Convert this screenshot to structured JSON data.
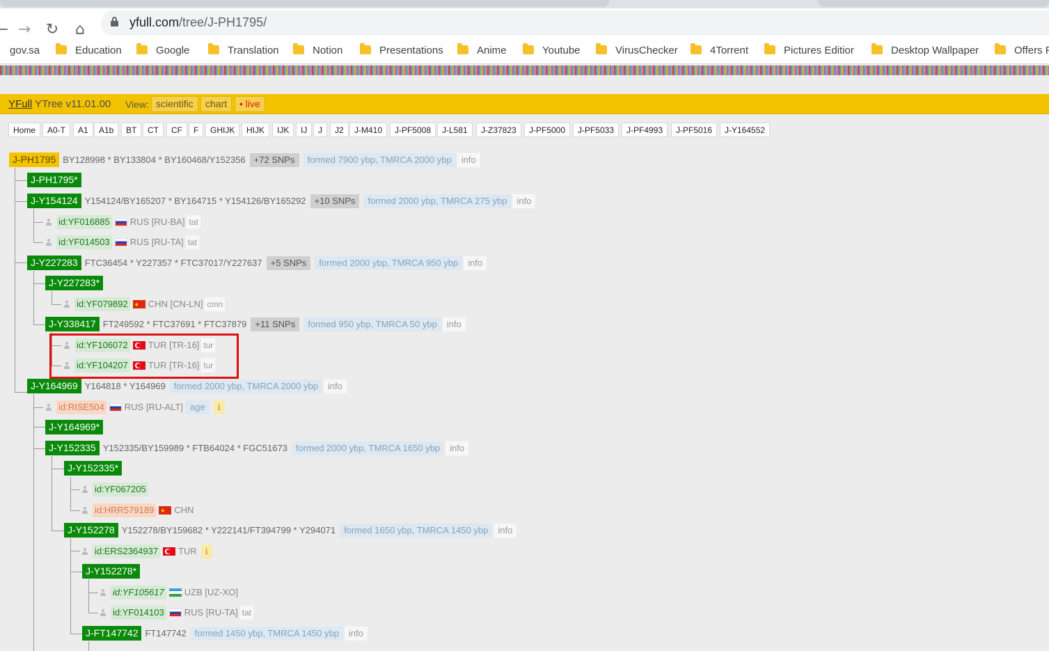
{
  "browser": {
    "url_host": "yfull.com",
    "url_path": "/tree/J-PH1795/",
    "bookmarks": [
      "gov.sa",
      "Education",
      "Google",
      "Translation",
      "Notion",
      "Presentations",
      "Anime",
      "Youtube",
      "VirusChecker",
      "4Torrent",
      "Pictures Editior",
      "Desktop Wallpaper",
      "Offers F"
    ]
  },
  "header": {
    "brand": "YFull",
    "title_rest": " YTree v11.01.00",
    "view_label": "View:",
    "views": [
      "scientific",
      "chart",
      "• live"
    ]
  },
  "nav_tabs": [
    "Home",
    "A0-T",
    "A1",
    "A1b",
    "BT",
    "CT",
    "CF",
    "F",
    "GHIJK",
    "HIJK",
    "IJK",
    "IJ",
    "J",
    "J2",
    "J-M410",
    "J-PF5008",
    "J-L581",
    "J-Z37823",
    "J-PF5000",
    "J-PF5033",
    "J-PF4993",
    "J-PF5016",
    "J-Y164552"
  ],
  "tree": {
    "root": {
      "name": "J-PH1795",
      "snps": "BY128998 * BY133804 * BY160468/Y152356",
      "more": "+72 SNPs",
      "formed": "formed 7900 ybp, TMRCA 2000 ybp",
      "info": "info"
    },
    "n1": {
      "name": "J-PH1795*"
    },
    "n2": {
      "name": "J-Y154124",
      "snps": "Y154124/BY165207 * BY164715 * Y154126/BY165292",
      "more": "+10 SNPs",
      "formed": "formed 2000 ybp, TMRCA 275 ybp",
      "info": "info"
    },
    "s1": {
      "id": "id:YF016885",
      "loc": "RUS [RU-BA]",
      "lang": "tat"
    },
    "s2": {
      "id": "id:YF014503",
      "loc": "RUS [RU-TA]",
      "lang": "tat"
    },
    "n3": {
      "name": "J-Y227283",
      "snps": "FTC36454 * Y227357 * FTC37017/Y227637",
      "more": "+5 SNPs",
      "formed": "formed 2000 ybp, TMRCA 950 ybp",
      "info": "info"
    },
    "n4": {
      "name": "J-Y227283*"
    },
    "s3": {
      "id": "id:YF079892",
      "loc": "CHN [CN-LN]",
      "lang": "cmn"
    },
    "n5": {
      "name": "J-Y338417",
      "snps": "FT249592 * FTC37691 * FTC37879",
      "more": "+11 SNPs",
      "formed": "formed 950 ybp, TMRCA 50 ybp",
      "info": "info"
    },
    "s4": {
      "id": "id:YF106072",
      "loc": "TUR [TR-16]",
      "lang": "tur"
    },
    "s5": {
      "id": "id:YF104207",
      "loc": "TUR [TR-16]",
      "lang": "tur"
    },
    "n6": {
      "name": "J-Y164969",
      "snps": "Y164818 * Y164969",
      "formed": "formed 2000 ybp, TMRCA 2000 ybp",
      "info": "info"
    },
    "s6": {
      "id": "id:RISE504",
      "loc": "RUS [RU-ALT]",
      "age": "age",
      "i": "i"
    },
    "n7": {
      "name": "J-Y164969*"
    },
    "n8": {
      "name": "J-Y152335",
      "snps": "Y152335/BY159989 * FTB64024 * FGC51673",
      "formed": "formed 2000 ybp, TMRCA 1650 ybp",
      "info": "info"
    },
    "n9": {
      "name": "J-Y152335*"
    },
    "s7": {
      "id": "id:YF067205"
    },
    "s8": {
      "id": "id:HRR579189",
      "loc": "CHN"
    },
    "n10": {
      "name": "J-Y152278",
      "snps": "Y152278/BY159682 * Y222141/FT394799 * Y294071",
      "formed": "formed 1650 ybp, TMRCA 1450 ybp",
      "info": "info"
    },
    "s9": {
      "id": "id:ERS2364937",
      "loc": "TUR",
      "i": "i"
    },
    "n11": {
      "name": "J-Y152278*"
    },
    "s10": {
      "id": "id:YF105617",
      "loc": "UZB [UZ-XO]"
    },
    "s11": {
      "id": "id:YF014103",
      "loc": "RUS [RU-TA]",
      "lang": "tat"
    },
    "n12": {
      "name": "J-FT147742",
      "snps": "FT147742",
      "formed": "formed 1450 ybp, TMRCA 1450 ybp",
      "info": "info"
    }
  }
}
